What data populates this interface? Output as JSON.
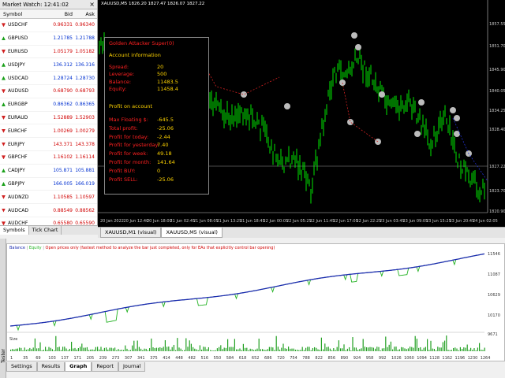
{
  "market_watch": {
    "title": "Market Watch: 12:41:02",
    "close_glyph": "×",
    "columns": [
      "Symbol",
      "Bid",
      "Ask"
    ],
    "rows": [
      {
        "symbol": "USDCHF",
        "bid": "0.96331",
        "ask": "0.96340",
        "dir": "down"
      },
      {
        "symbol": "GBPUSD",
        "bid": "1.21785",
        "ask": "1.21788",
        "dir": "up"
      },
      {
        "symbol": "EURUSD",
        "bid": "1.05179",
        "ask": "1.05182",
        "dir": "down"
      },
      {
        "symbol": "USDJPY",
        "bid": "136.312",
        "ask": "136.316",
        "dir": "up"
      },
      {
        "symbol": "USDCAD",
        "bid": "1.28724",
        "ask": "1.28730",
        "dir": "up"
      },
      {
        "symbol": "AUDUSD",
        "bid": "0.68790",
        "ask": "0.68793",
        "dir": "down"
      },
      {
        "symbol": "EURGBP",
        "bid": "0.86362",
        "ask": "0.86365",
        "dir": "up"
      },
      {
        "symbol": "EURAUD",
        "bid": "1.52889",
        "ask": "1.52903",
        "dir": "down"
      },
      {
        "symbol": "EURCHF",
        "bid": "1.00269",
        "ask": "1.00279",
        "dir": "down"
      },
      {
        "symbol": "EURJPY",
        "bid": "143.371",
        "ask": "143.378",
        "dir": "down"
      },
      {
        "symbol": "GBPCHF",
        "bid": "1.16102",
        "ask": "1.16114",
        "dir": "down"
      },
      {
        "symbol": "CADJPY",
        "bid": "105.871",
        "ask": "105.881",
        "dir": "up"
      },
      {
        "symbol": "GBPJPY",
        "bid": "166.005",
        "ask": "166.019",
        "dir": "up"
      },
      {
        "symbol": "AUDNZD",
        "bid": "1.10585",
        "ask": "1.10597",
        "dir": "down"
      },
      {
        "symbol": "AUDCAD",
        "bid": "0.88549",
        "ask": "0.88562",
        "dir": "down"
      },
      {
        "symbol": "AUDCHF",
        "bid": "0.65580",
        "ask": "0.65590",
        "dir": "down"
      }
    ],
    "tabs": [
      "Symbols",
      "Tick Chart"
    ]
  },
  "chart": {
    "title": "XAUUSD,M5  1826.20 1827.47 1826.07 1827.22",
    "price_levels": [
      "1857.55",
      "1851.70",
      "1845.90",
      "1840.05",
      "1834.25",
      "1828.40",
      "1827.22",
      "1823.70",
      "1820.90"
    ],
    "time_labels": [
      "20 Jan 2022",
      "20 Jun 12:40",
      "20 Jun 18:00",
      "21 Jun 02:45",
      "21 Jun 08:05",
      "21 Jun 13:25",
      "21 Jun 18:45",
      "22 Jun 00:05",
      "22 Jun 05:25",
      "22 Jun 11:45",
      "22 Jun 17:05",
      "22 Jun 22:25",
      "23 Jun 03:45",
      "23 Jun 09:05",
      "23 Jun 15:25",
      "23 Jun 20:45",
      "24 Jun 02:05"
    ],
    "colors": {
      "background": "#000000",
      "candles": "#00ff00",
      "label_red": "#ff2020",
      "value_yellow": "#ffd400"
    }
  },
  "info_panel": {
    "title": "Golden Attacker Super(0)",
    "section1": "Account information",
    "rows1": [
      {
        "label": "Spread:",
        "value": "20"
      },
      {
        "label": "Leverage:",
        "value": "500"
      },
      {
        "label": "Balance:",
        "value": "11483.5"
      },
      {
        "label": "Equity:",
        "value": "11458.4"
      }
    ],
    "section2": "Profit on account",
    "rows2": [
      {
        "label": "Max Floating $:",
        "value": "-645.5"
      },
      {
        "label": "Total profit:",
        "value": "-25.06"
      },
      {
        "label": "Profit for today:",
        "value": "-2.44"
      },
      {
        "label": "Profit for yesterday:",
        "value": "7.40"
      },
      {
        "label": "Profit for week:",
        "value": "49.18"
      },
      {
        "label": "Profit for month:",
        "value": "141.64"
      },
      {
        "label": "Profit BUY:",
        "value": "0"
      },
      {
        "label": "Profit SELL:",
        "value": "-25.06"
      }
    ]
  },
  "chart_tabs": [
    "XAUUSD,M1 (visual)",
    "XAUUSD,M5 (visual)"
  ],
  "tester": {
    "side_label": "Tester",
    "legend_balance": "Balance",
    "legend_equity": "Equity",
    "legend_note": "Open prices only (fastest method to analyze the bar just completed, only for EAs that explicitly control bar opening)",
    "size_label": "Size",
    "y_labels": [
      "11546",
      "11087",
      "10629",
      "10170",
      "9671"
    ],
    "x_labels": [
      "1",
      "35",
      "69",
      "103",
      "137",
      "171",
      "205",
      "239",
      "273",
      "307",
      "341",
      "375",
      "414",
      "448",
      "482",
      "516",
      "550",
      "584",
      "618",
      "652",
      "686",
      "720",
      "754",
      "788",
      "822",
      "856",
      "890",
      "924",
      "958",
      "992",
      "1026",
      "1060",
      "1094",
      "1128",
      "1162",
      "1196",
      "1230",
      "1264"
    ],
    "tabs": [
      "Settings",
      "Results",
      "Graph",
      "Report",
      "Journal"
    ],
    "active_tab": "Graph",
    "colors": {
      "balance": "#1c2cb0",
      "equity": "#22b222",
      "size_bars": "#22a022"
    }
  }
}
